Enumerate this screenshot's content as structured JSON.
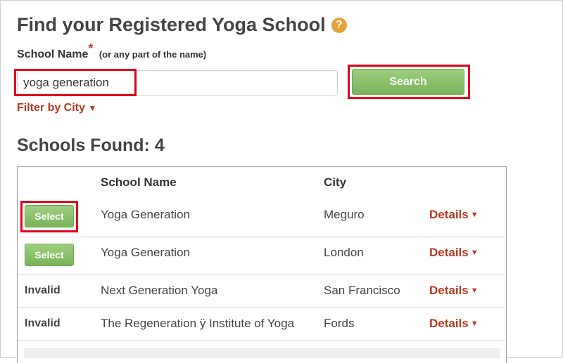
{
  "page": {
    "title": "Find your Registered Yoga School",
    "help_icon": "?",
    "field_label": "School Name",
    "required_mark": "*",
    "field_hint": "(or any part of the name)",
    "search_value": "yoga generation",
    "search_button": "Search",
    "filter_label": "Filter by City",
    "filter_arrow": "▼",
    "results_title": "Schools Found: 4"
  },
  "table": {
    "headers": {
      "name": "School Name",
      "city": "City"
    },
    "rows": [
      {
        "action": "Select",
        "name": "Yoga Generation",
        "city": "Meguro",
        "details": "Details"
      },
      {
        "action": "Select",
        "name": "Yoga Generation",
        "city": "London",
        "details": "Details"
      },
      {
        "action": "Invalid",
        "name": "Next Generation Yoga",
        "city": "San Francisco",
        "details": "Details"
      },
      {
        "action": "Invalid",
        "name": "The Regeneration ÿ Institute of Yoga",
        "city": "Fords",
        "details": "Details"
      }
    ],
    "details_arrow": "▼"
  },
  "colors": {
    "accent_green": "#78b45a",
    "link_red": "#b23a22",
    "highlight": "#e0001b",
    "help_orange": "#e6a23c"
  }
}
